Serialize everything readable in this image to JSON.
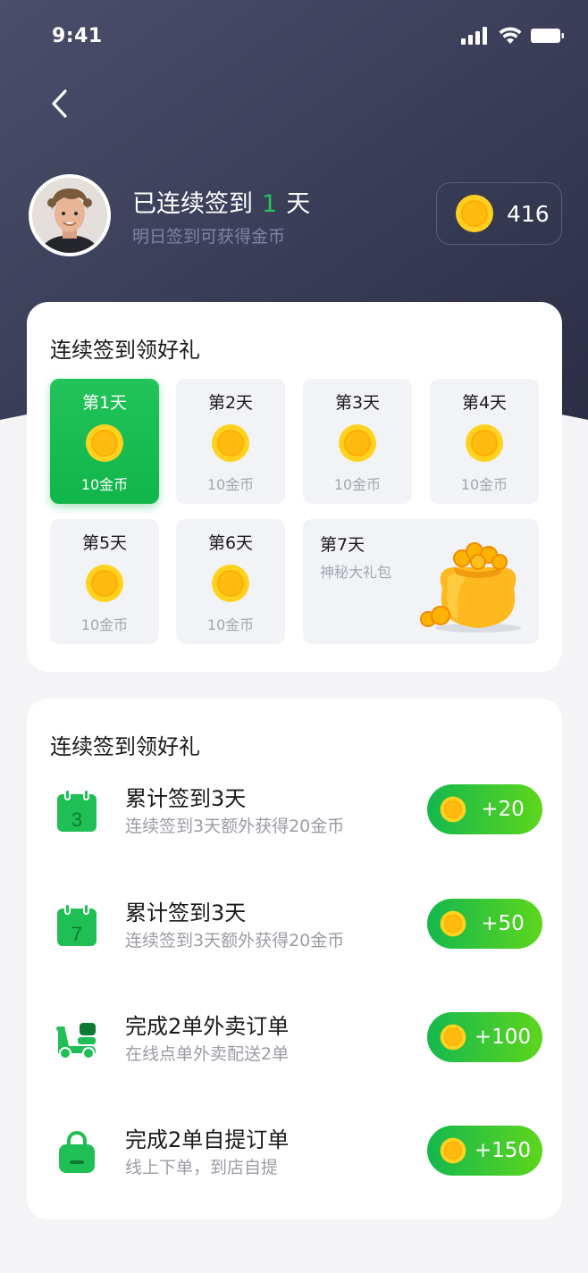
{
  "status_bar": {
    "time": "9:41"
  },
  "header": {
    "streak_prefix": "已连续签到",
    "streak_days": "1",
    "streak_suffix": "天",
    "streak_subtitle": "明日签到可获得金币",
    "coin_balance": "416"
  },
  "checkin_card": {
    "title": "连续签到领好礼",
    "days": [
      {
        "label": "第1天",
        "amount": "10金币",
        "active": true
      },
      {
        "label": "第2天",
        "amount": "10金币",
        "active": false
      },
      {
        "label": "第3天",
        "amount": "10金币",
        "active": false
      },
      {
        "label": "第4天",
        "amount": "10金币",
        "active": false
      },
      {
        "label": "第5天",
        "amount": "10金币",
        "active": false
      },
      {
        "label": "第6天",
        "amount": "10金币",
        "active": false
      }
    ],
    "day7": {
      "label": "第7天",
      "subtitle": "神秘大礼包"
    }
  },
  "tasks_card": {
    "title": "连续签到领好礼",
    "tasks": [
      {
        "icon": "calendar-icon",
        "icon_number": "3",
        "title": "累计签到3天",
        "subtitle": "连续签到3天额外获得20金币",
        "reward": "+20"
      },
      {
        "icon": "calendar-icon",
        "icon_number": "7",
        "title": "累计签到3天",
        "subtitle": "连续签到3天额外获得20金币",
        "reward": "+50"
      },
      {
        "icon": "scooter-icon",
        "title": "完成2单外卖订单",
        "subtitle": "在线点单外卖配送2单",
        "reward": "+100"
      },
      {
        "icon": "shopping-bag-icon",
        "title": "完成2单自提订单",
        "subtitle": "线上下单，到店自提",
        "reward": "+150"
      }
    ]
  },
  "colors": {
    "header_bg_top": "#464a66",
    "header_bg_bottom": "#2c2f46",
    "accent_green": "#14b84e",
    "coin_gold": "#ffb300"
  }
}
